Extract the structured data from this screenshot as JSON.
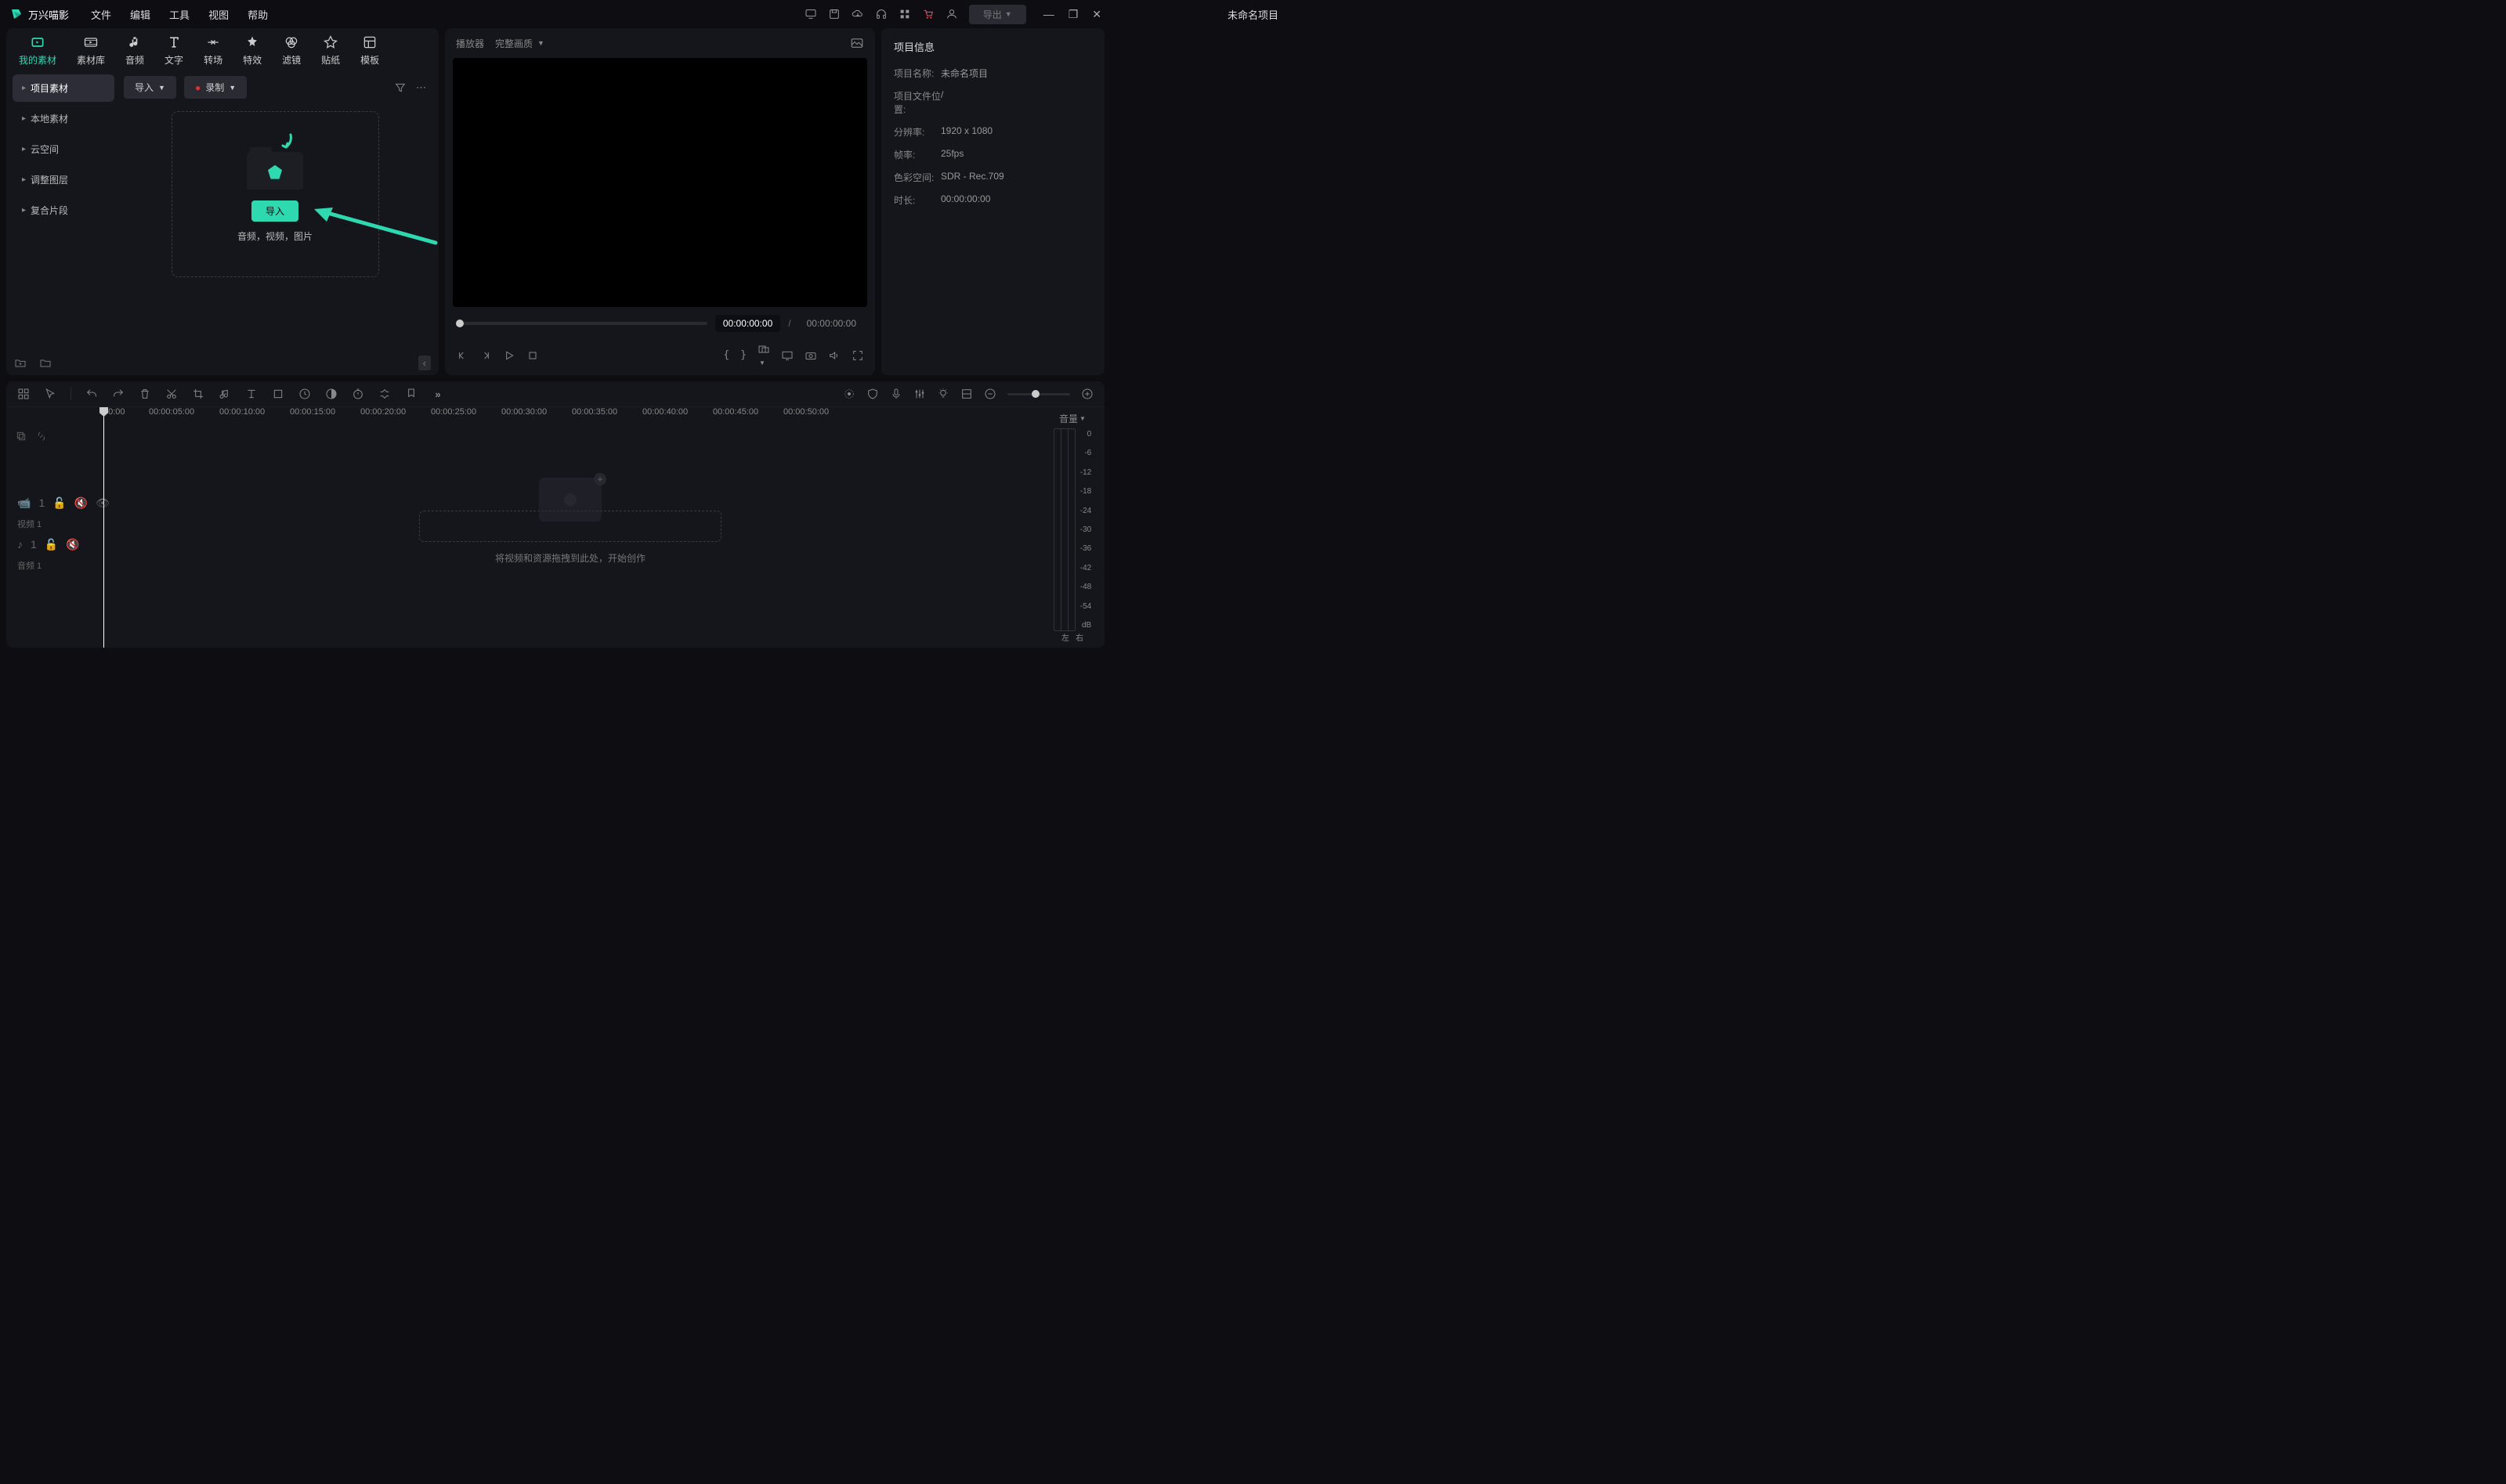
{
  "app": {
    "name": "万兴喵影",
    "title": "未命名项目"
  },
  "menu": [
    "文件",
    "编辑",
    "工具",
    "视图",
    "帮助"
  ],
  "titlebar": {
    "export_label": "导出"
  },
  "asset_tabs": [
    {
      "label": "我的素材",
      "active": true
    },
    {
      "label": "素材库"
    },
    {
      "label": "音频"
    },
    {
      "label": "文字"
    },
    {
      "label": "转场"
    },
    {
      "label": "特效"
    },
    {
      "label": "滤镜"
    },
    {
      "label": "贴纸"
    },
    {
      "label": "模板"
    }
  ],
  "sidebar": [
    {
      "label": "项目素材",
      "active": true
    },
    {
      "label": "本地素材"
    },
    {
      "label": "云空间"
    },
    {
      "label": "调整图层"
    },
    {
      "label": "复合片段"
    }
  ],
  "content_toolbar": {
    "import": "导入",
    "record": "录制"
  },
  "dropzone": {
    "button": "导入",
    "hint": "音频，视频，图片"
  },
  "preview": {
    "player_label": "播放器",
    "quality": "完整画质",
    "time_current": "00:00:00:00",
    "time_total": "00:00:00:00",
    "sep": "/"
  },
  "info": {
    "title": "项目信息",
    "rows": [
      {
        "label": "项目名称:",
        "val": "未命名项目"
      },
      {
        "label": "项目文件位置:",
        "val": "/"
      },
      {
        "label": "分辨率:",
        "val": "1920 x 1080"
      },
      {
        "label": "帧率:",
        "val": "25fps"
      },
      {
        "label": "色彩空间:",
        "val": "SDR - Rec.709"
      },
      {
        "label": "时长:",
        "val": "00:00:00:00"
      }
    ]
  },
  "timeline": {
    "ruler": [
      "00:00",
      "00:00:05:00",
      "00:00:10:00",
      "00:00:15:00",
      "00:00:20:00",
      "00:00:25:00",
      "00:00:30:00",
      "00:00:35:00",
      "00:00:40:00",
      "00:00:45:00",
      "00:00:50:00"
    ],
    "tracks": [
      {
        "name": "视频 1",
        "idx": "1"
      },
      {
        "name": "音频 1",
        "idx": "1"
      }
    ],
    "drop_hint": "将视频和资源拖拽到此处，开始创作",
    "meter": {
      "label": "音量",
      "scale": [
        "0",
        "-6",
        "-12",
        "-18",
        "-24",
        "-30",
        "-36",
        "-42",
        "-48",
        "-54",
        "dB"
      ],
      "footer": [
        "左",
        "右"
      ]
    }
  }
}
